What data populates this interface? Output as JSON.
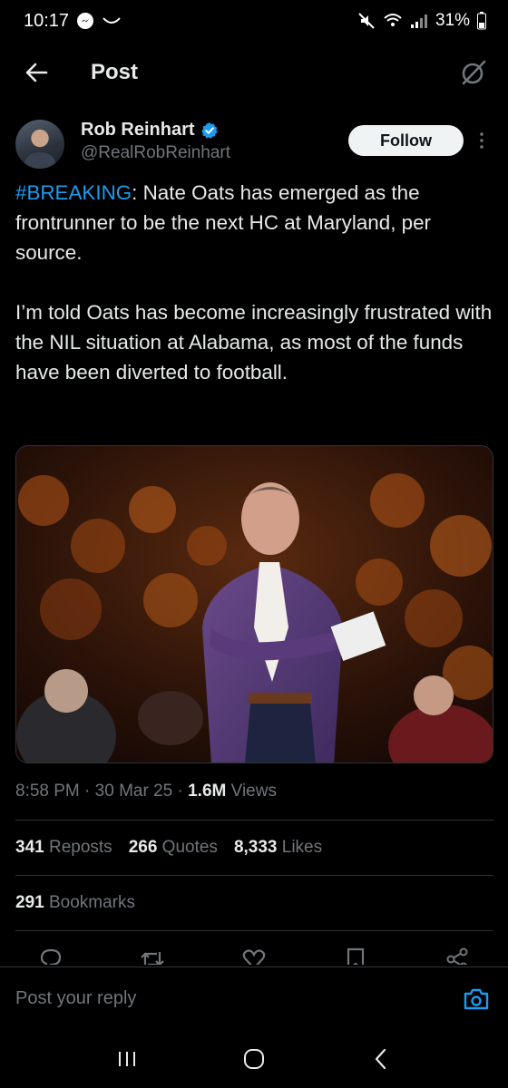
{
  "status_bar": {
    "time": "10:17",
    "battery": "31%"
  },
  "header": {
    "title": "Post"
  },
  "author": {
    "display_name": "Rob Reinhart",
    "handle": "@RealRobReinhart",
    "verified": true,
    "follow_label": "Follow"
  },
  "tweet": {
    "hashtag": "#BREAKING",
    "line1_rest": ": Nate Oats has emerged as the frontrunner to be the next HC at Maryland, per source.",
    "paragraph2": "I’m told Oats has become increasingly frustrated with the NIL situation at Alabama, as most of the funds have been diverted to football."
  },
  "meta": {
    "time": "8:58 PM",
    "date": "30 Mar 25",
    "views_count": "1.6M",
    "views_label": "Views"
  },
  "stats": {
    "reposts_count": "341",
    "reposts_label": "Reposts",
    "quotes_count": "266",
    "quotes_label": "Quotes",
    "likes_count": "8,333",
    "likes_label": "Likes",
    "bookmarks_count": "291",
    "bookmarks_label": "Bookmarks"
  },
  "reply": {
    "placeholder": "Post your reply"
  },
  "icons": {
    "back": "arrow-left-icon",
    "grok": "grok-icon",
    "verified": "verified-badge-icon",
    "more": "more-vertical-icon",
    "reply": "reply-icon",
    "repost": "repost-icon",
    "like": "heart-icon",
    "bookmark": "bookmark-icon",
    "share": "share-icon",
    "camera": "camera-icon"
  },
  "colors": {
    "background": "#000000",
    "accent": "#1d9bf0",
    "text_primary": "#e7e9ea",
    "text_secondary": "#71767b"
  }
}
